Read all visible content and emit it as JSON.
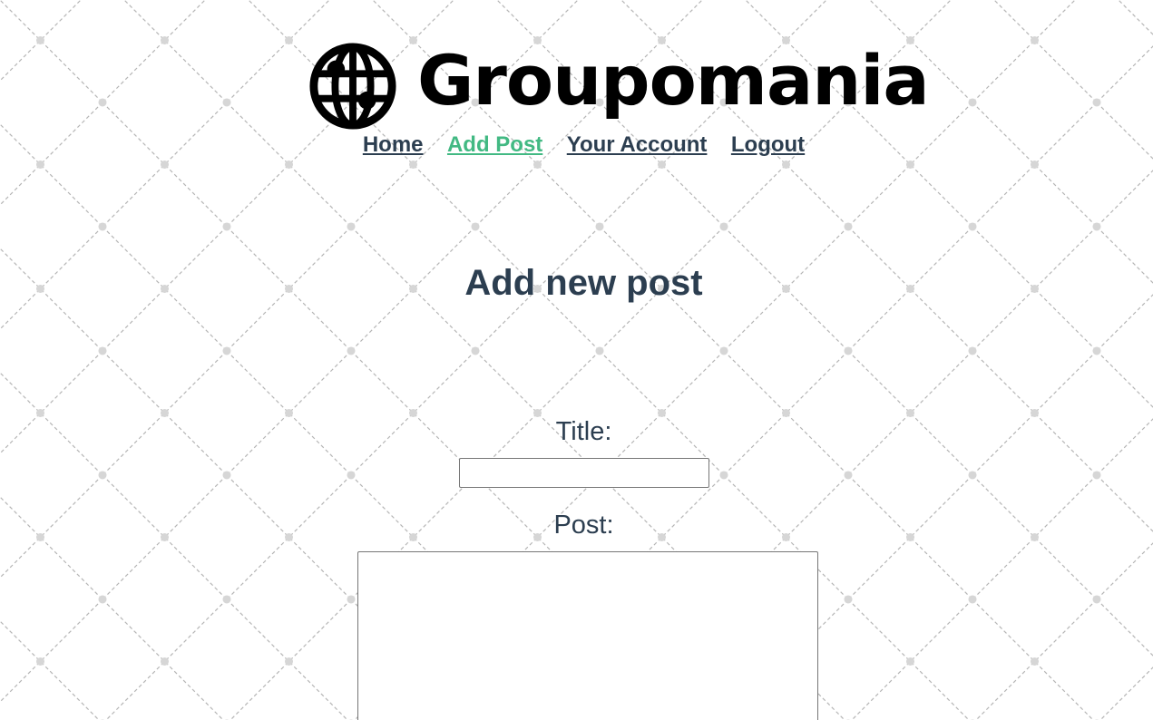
{
  "brand": {
    "name": "Groupomania",
    "icon": "globe-icon"
  },
  "nav": {
    "items": [
      {
        "label": "Home",
        "active": false
      },
      {
        "label": "Add Post",
        "active": true
      },
      {
        "label": "Your Account",
        "active": false
      },
      {
        "label": "Logout",
        "active": false
      }
    ]
  },
  "page": {
    "heading": "Add new post"
  },
  "form": {
    "title_label": "Title:",
    "title_value": "",
    "post_label": "Post:",
    "post_value": ""
  },
  "colors": {
    "text": "#2c3e50",
    "active_link": "#42b983",
    "pattern": "#b5b5b5"
  }
}
